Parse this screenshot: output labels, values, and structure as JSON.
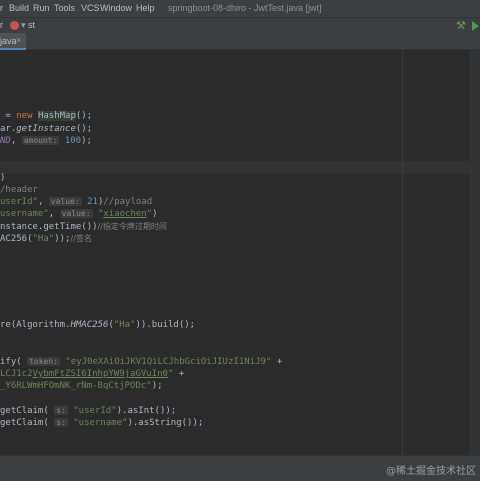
{
  "menubar": {
    "items": [
      "r",
      "Build",
      "Run",
      "Tools",
      "VCS",
      "Window",
      "Help"
    ],
    "title": "springboot-08-dhiro - JwtTest.java [jwt]"
  },
  "toolbar": {
    "run_config": "st",
    "left_fragment": "r"
  },
  "tabs": [
    {
      "label": "java"
    }
  ],
  "editor": {
    "lines": {
      "l1_a": " = ",
      "l1_kw": "new ",
      "l1_cls": "HashMap",
      "l1_b": "();",
      "l2_a": "ar.",
      "l2_it": "getInstance",
      "l2_b": "();",
      "l3_it": "ND",
      "l3_a": ", ",
      "l3_hint": "amount:",
      "l3_num": "100",
      "l3_b": ");",
      "l4": ")",
      "l5": "/header",
      "l6_str": "userId\"",
      "l6_a": ", ",
      "l6_hint": "value:",
      "l6_num": "21",
      "l6_b": ")",
      "l6_com": "//payload",
      "l7_str": "username\"",
      "l7_a": ", ",
      "l7_hint": "value:",
      "l7_str2": "\"",
      "l7_ul": "xiaochen",
      "l7_str3": "\"",
      "l7_b": ")",
      "l8_a": "nstance.getTime())",
      "l8_com": "//指定令牌过期时间",
      "l9_a": "AC256(",
      "l9_str": "\"Ha\"",
      "l9_b": "));",
      "l9_com": "//签名",
      "l10_a": "re(Algorithm.",
      "l10_it": "HMAC256",
      "l10_b": "(",
      "l10_str": "\"Ha\"",
      "l10_c": ")).build();",
      "l11_a": "ify( ",
      "l11_hint": "token:",
      "l11_str": "\"eyJ0eXAiOiJKV1QiLCJhbGciOiJIUzI1NiJ9\"",
      "l11_b": " +",
      "l12_str": "LCJ1c2",
      "l12_ul": "VybmFtZSI6InhpYW9jaGVuIn0",
      "l12_str2": "\"",
      "l12_b": " +",
      "l13_str": "_Y6RLWmHFOmNK_rNm-BqCtjPODc\"",
      "l13_b": ");",
      "l14_a": "getClaim( ",
      "l14_hint": "s:",
      "l14_str": "\"userId\"",
      "l14_b": ").asInt());",
      "l15_a": "getClaim( ",
      "l15_hint": "s:",
      "l15_str": "\"username\"",
      "l15_b": ").asString());"
    }
  },
  "watermark": "@稀土掘金技术社区",
  "colors": {
    "background": "#2b2b2b",
    "chrome": "#3c3f41",
    "keyword": "#cc7832",
    "string": "#6a8759",
    "number": "#6897bb",
    "comment": "#808080",
    "accent": "#4a88c7"
  }
}
